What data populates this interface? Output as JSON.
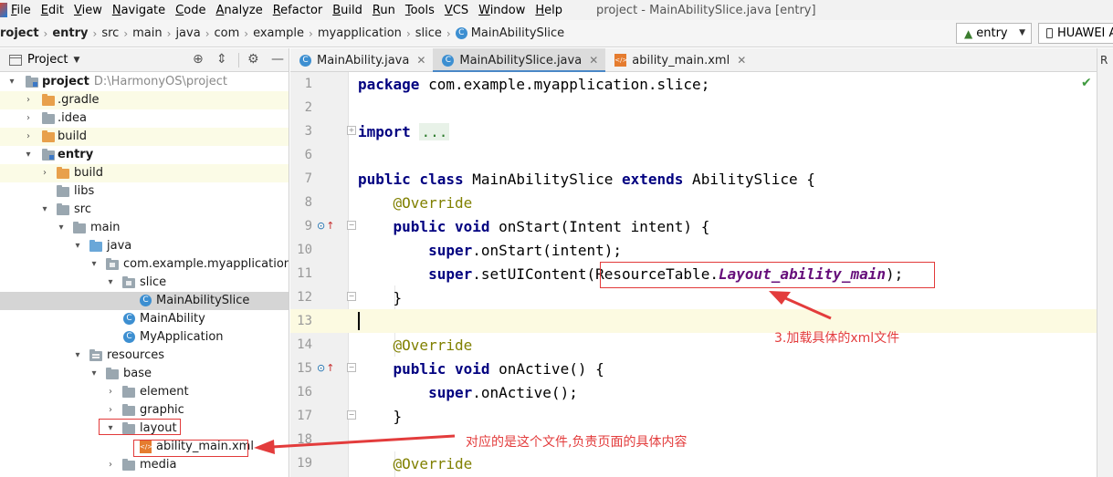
{
  "menubar": {
    "items": [
      "File",
      "Edit",
      "View",
      "Navigate",
      "Code",
      "Analyze",
      "Refactor",
      "Build",
      "Run",
      "Tools",
      "VCS",
      "Window",
      "Help"
    ],
    "window_title": "project - MainAbilitySlice.java [entry]"
  },
  "navbar": {
    "crumbs": [
      "roject",
      "entry",
      "src",
      "main",
      "java",
      "com",
      "example",
      "myapplication",
      "slice"
    ],
    "file_crumb": "MainAbilitySlice",
    "run_config": "entry",
    "device": "HUAWEI A"
  },
  "project_panel": {
    "title": "Project",
    "tree": [
      {
        "label": "project",
        "hint": "D:\\HarmonyOS\\project",
        "bold": true
      },
      {
        "label": ".gradle"
      },
      {
        "label": ".idea"
      },
      {
        "label": "build"
      },
      {
        "label": "entry",
        "bold": true
      },
      {
        "label": "build"
      },
      {
        "label": "libs"
      },
      {
        "label": "src"
      },
      {
        "label": "main"
      },
      {
        "label": "java"
      },
      {
        "label": "com.example.myapplication"
      },
      {
        "label": "slice"
      },
      {
        "label": "MainAbilitySlice"
      },
      {
        "label": "MainAbility"
      },
      {
        "label": "MyApplication"
      },
      {
        "label": "resources"
      },
      {
        "label": "base"
      },
      {
        "label": "element"
      },
      {
        "label": "graphic"
      },
      {
        "label": "layout"
      },
      {
        "label": "ability_main.xml"
      },
      {
        "label": "media"
      }
    ]
  },
  "editor": {
    "tabs": [
      {
        "label": "MainAbility.java",
        "active": false
      },
      {
        "label": "MainAbilitySlice.java",
        "active": true
      },
      {
        "label": "ability_main.xml",
        "active": false
      }
    ],
    "right_strip_label": "R",
    "line_numbers": [
      "1",
      "2",
      "3",
      "6",
      "7",
      "8",
      "9",
      "10",
      "11",
      "12",
      "13",
      "14",
      "15",
      "16",
      "17",
      "18",
      "19"
    ],
    "code": {
      "l1_kw": "package",
      "l1_rest": " com.example.myapplication.slice;",
      "l3_kw": "import",
      "l3_dots": "...",
      "l7_kw1": "public class",
      "l7_mid": " MainAbilitySlice ",
      "l7_kw2": "extends",
      "l7_rest": " AbilitySlice {",
      "l8_ann": "@Override",
      "l9_kw": "public void",
      "l9_rest": " onStart(Intent intent) {",
      "l10_kw": "super",
      "l10_rest": ".onStart(intent);",
      "l11_kw": "super",
      "l11_mid": ".setUIContent(",
      "l11_cls": "ResourceTable.",
      "l11_method": "Layout_ability_main",
      "l11_end": ");",
      "l12": "}",
      "l14_ann": "@Override",
      "l15_kw": "public void",
      "l15_rest": " onActive() {",
      "l16_kw": "super",
      "l16_rest": ".onActive();",
      "l17": "}",
      "l19_ann": "@Override"
    }
  },
  "annotations": {
    "note_layout": "3.加载具体的xml文件",
    "note_file": "对应的是这个文件,负责页面的具体内容"
  },
  "colors": {
    "annotation_red": "#e33c3c",
    "keyword": "#000080",
    "active_tab_accent": "#4a88c7"
  }
}
